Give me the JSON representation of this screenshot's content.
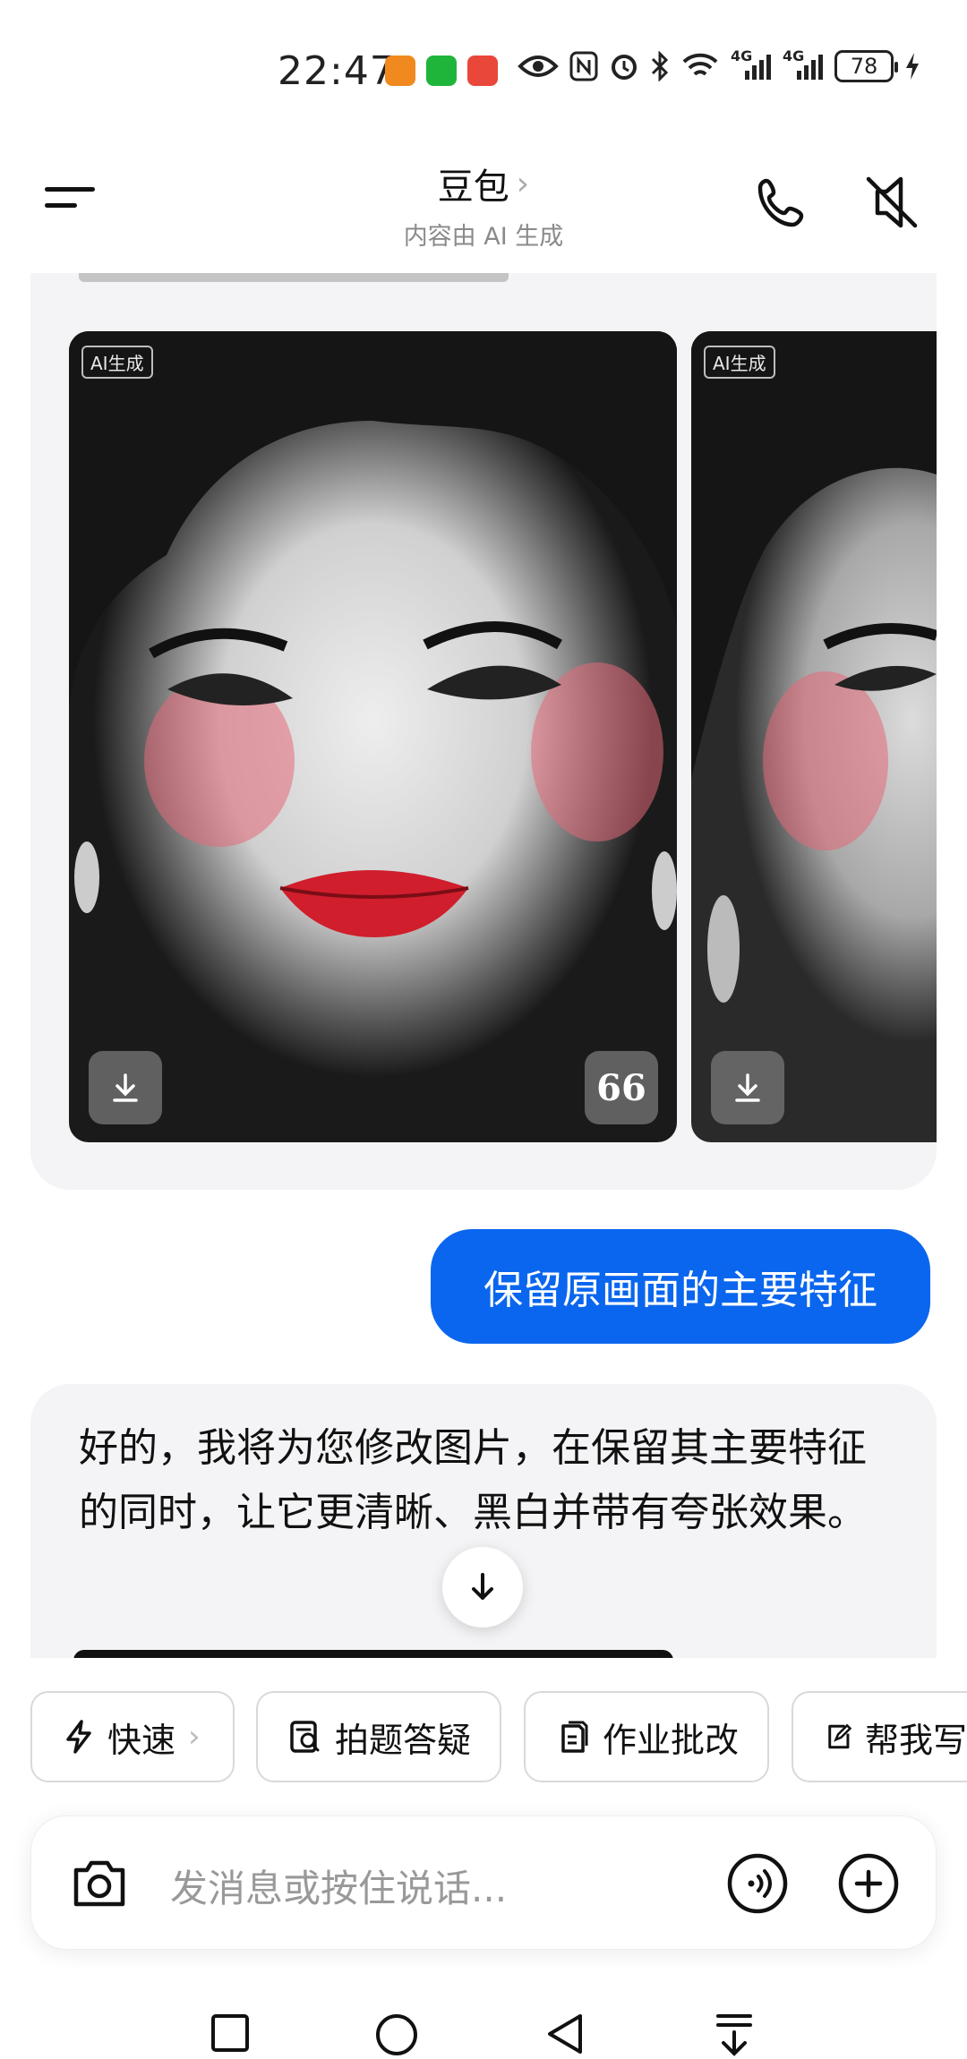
{
  "status_bar": {
    "time": "22:47",
    "network_labels": [
      "4G",
      "4G"
    ],
    "battery": "78"
  },
  "header": {
    "title": "豆包",
    "title_chevron": "›",
    "subtitle": "内容由 AI 生成",
    "icons": [
      "menu-icon",
      "phone-icon",
      "speaker-muted-icon"
    ]
  },
  "chat": {
    "image_cards": [
      {
        "ai_tag": "AI生成"
      },
      {
        "ai_tag": "AI生成"
      }
    ],
    "quote_button_label": "66",
    "user_message": "保留原画面的主要特征",
    "bot_reply": "好的，我将为您修改图片，在保留其主要特征的同时，让它更清晰、黑白并带有夸张效果。"
  },
  "quick_actions": [
    {
      "label": "快速",
      "icon": "lightning-icon",
      "has_chevron": true,
      "chevron": "›"
    },
    {
      "label": "拍题答疑",
      "icon": "scan-question-icon"
    },
    {
      "label": "作业批改",
      "icon": "homework-icon"
    },
    {
      "label": "帮我写",
      "icon": "edit-icon"
    }
  ],
  "input": {
    "placeholder": "发消息或按住说话..."
  },
  "colors": {
    "accent_blue": "#0a66ee",
    "bot_bubble_bg": "#f4f4f6"
  }
}
